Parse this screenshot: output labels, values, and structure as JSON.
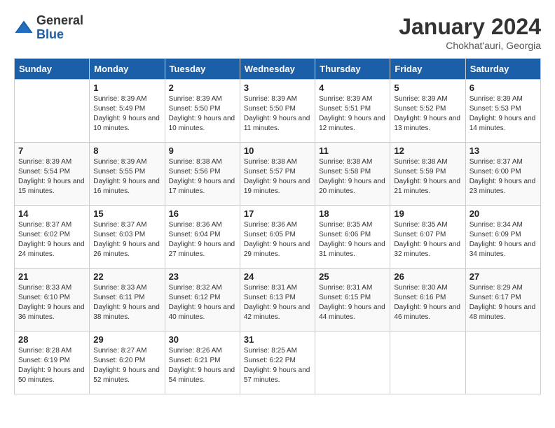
{
  "logo": {
    "general": "General",
    "blue": "Blue"
  },
  "header": {
    "month": "January 2024",
    "location": "Chokhat'auri, Georgia"
  },
  "weekdays": [
    "Sunday",
    "Monday",
    "Tuesday",
    "Wednesday",
    "Thursday",
    "Friday",
    "Saturday"
  ],
  "weeks": [
    [
      {
        "day": "",
        "sunrise": "",
        "sunset": "",
        "daylight": ""
      },
      {
        "day": "1",
        "sunrise": "Sunrise: 8:39 AM",
        "sunset": "Sunset: 5:49 PM",
        "daylight": "Daylight: 9 hours and 10 minutes."
      },
      {
        "day": "2",
        "sunrise": "Sunrise: 8:39 AM",
        "sunset": "Sunset: 5:50 PM",
        "daylight": "Daylight: 9 hours and 10 minutes."
      },
      {
        "day": "3",
        "sunrise": "Sunrise: 8:39 AM",
        "sunset": "Sunset: 5:50 PM",
        "daylight": "Daylight: 9 hours and 11 minutes."
      },
      {
        "day": "4",
        "sunrise": "Sunrise: 8:39 AM",
        "sunset": "Sunset: 5:51 PM",
        "daylight": "Daylight: 9 hours and 12 minutes."
      },
      {
        "day": "5",
        "sunrise": "Sunrise: 8:39 AM",
        "sunset": "Sunset: 5:52 PM",
        "daylight": "Daylight: 9 hours and 13 minutes."
      },
      {
        "day": "6",
        "sunrise": "Sunrise: 8:39 AM",
        "sunset": "Sunset: 5:53 PM",
        "daylight": "Daylight: 9 hours and 14 minutes."
      }
    ],
    [
      {
        "day": "7",
        "sunrise": "Sunrise: 8:39 AM",
        "sunset": "Sunset: 5:54 PM",
        "daylight": "Daylight: 9 hours and 15 minutes."
      },
      {
        "day": "8",
        "sunrise": "Sunrise: 8:39 AM",
        "sunset": "Sunset: 5:55 PM",
        "daylight": "Daylight: 9 hours and 16 minutes."
      },
      {
        "day": "9",
        "sunrise": "Sunrise: 8:38 AM",
        "sunset": "Sunset: 5:56 PM",
        "daylight": "Daylight: 9 hours and 17 minutes."
      },
      {
        "day": "10",
        "sunrise": "Sunrise: 8:38 AM",
        "sunset": "Sunset: 5:57 PM",
        "daylight": "Daylight: 9 hours and 19 minutes."
      },
      {
        "day": "11",
        "sunrise": "Sunrise: 8:38 AM",
        "sunset": "Sunset: 5:58 PM",
        "daylight": "Daylight: 9 hours and 20 minutes."
      },
      {
        "day": "12",
        "sunrise": "Sunrise: 8:38 AM",
        "sunset": "Sunset: 5:59 PM",
        "daylight": "Daylight: 9 hours and 21 minutes."
      },
      {
        "day": "13",
        "sunrise": "Sunrise: 8:37 AM",
        "sunset": "Sunset: 6:00 PM",
        "daylight": "Daylight: 9 hours and 23 minutes."
      }
    ],
    [
      {
        "day": "14",
        "sunrise": "Sunrise: 8:37 AM",
        "sunset": "Sunset: 6:02 PM",
        "daylight": "Daylight: 9 hours and 24 minutes."
      },
      {
        "day": "15",
        "sunrise": "Sunrise: 8:37 AM",
        "sunset": "Sunset: 6:03 PM",
        "daylight": "Daylight: 9 hours and 26 minutes."
      },
      {
        "day": "16",
        "sunrise": "Sunrise: 8:36 AM",
        "sunset": "Sunset: 6:04 PM",
        "daylight": "Daylight: 9 hours and 27 minutes."
      },
      {
        "day": "17",
        "sunrise": "Sunrise: 8:36 AM",
        "sunset": "Sunset: 6:05 PM",
        "daylight": "Daylight: 9 hours and 29 minutes."
      },
      {
        "day": "18",
        "sunrise": "Sunrise: 8:35 AM",
        "sunset": "Sunset: 6:06 PM",
        "daylight": "Daylight: 9 hours and 31 minutes."
      },
      {
        "day": "19",
        "sunrise": "Sunrise: 8:35 AM",
        "sunset": "Sunset: 6:07 PM",
        "daylight": "Daylight: 9 hours and 32 minutes."
      },
      {
        "day": "20",
        "sunrise": "Sunrise: 8:34 AM",
        "sunset": "Sunset: 6:09 PM",
        "daylight": "Daylight: 9 hours and 34 minutes."
      }
    ],
    [
      {
        "day": "21",
        "sunrise": "Sunrise: 8:33 AM",
        "sunset": "Sunset: 6:10 PM",
        "daylight": "Daylight: 9 hours and 36 minutes."
      },
      {
        "day": "22",
        "sunrise": "Sunrise: 8:33 AM",
        "sunset": "Sunset: 6:11 PM",
        "daylight": "Daylight: 9 hours and 38 minutes."
      },
      {
        "day": "23",
        "sunrise": "Sunrise: 8:32 AM",
        "sunset": "Sunset: 6:12 PM",
        "daylight": "Daylight: 9 hours and 40 minutes."
      },
      {
        "day": "24",
        "sunrise": "Sunrise: 8:31 AM",
        "sunset": "Sunset: 6:13 PM",
        "daylight": "Daylight: 9 hours and 42 minutes."
      },
      {
        "day": "25",
        "sunrise": "Sunrise: 8:31 AM",
        "sunset": "Sunset: 6:15 PM",
        "daylight": "Daylight: 9 hours and 44 minutes."
      },
      {
        "day": "26",
        "sunrise": "Sunrise: 8:30 AM",
        "sunset": "Sunset: 6:16 PM",
        "daylight": "Daylight: 9 hours and 46 minutes."
      },
      {
        "day": "27",
        "sunrise": "Sunrise: 8:29 AM",
        "sunset": "Sunset: 6:17 PM",
        "daylight": "Daylight: 9 hours and 48 minutes."
      }
    ],
    [
      {
        "day": "28",
        "sunrise": "Sunrise: 8:28 AM",
        "sunset": "Sunset: 6:19 PM",
        "daylight": "Daylight: 9 hours and 50 minutes."
      },
      {
        "day": "29",
        "sunrise": "Sunrise: 8:27 AM",
        "sunset": "Sunset: 6:20 PM",
        "daylight": "Daylight: 9 hours and 52 minutes."
      },
      {
        "day": "30",
        "sunrise": "Sunrise: 8:26 AM",
        "sunset": "Sunset: 6:21 PM",
        "daylight": "Daylight: 9 hours and 54 minutes."
      },
      {
        "day": "31",
        "sunrise": "Sunrise: 8:25 AM",
        "sunset": "Sunset: 6:22 PM",
        "daylight": "Daylight: 9 hours and 57 minutes."
      },
      {
        "day": "",
        "sunrise": "",
        "sunset": "",
        "daylight": ""
      },
      {
        "day": "",
        "sunrise": "",
        "sunset": "",
        "daylight": ""
      },
      {
        "day": "",
        "sunrise": "",
        "sunset": "",
        "daylight": ""
      }
    ]
  ]
}
